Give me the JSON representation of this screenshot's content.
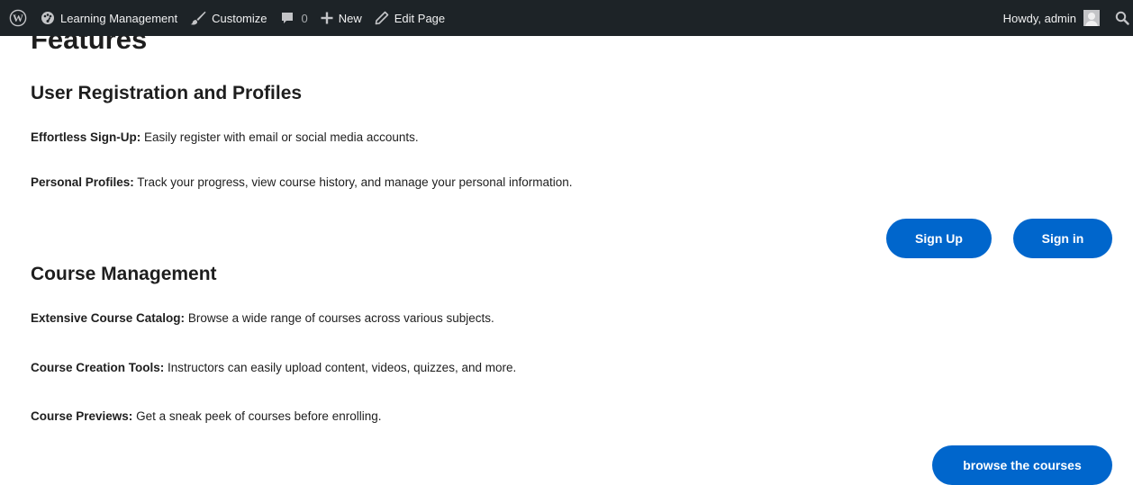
{
  "admin_bar": {
    "site_name": "Learning Management",
    "customize": "Customize",
    "comments_count": "0",
    "new": "New",
    "edit_page": "Edit Page",
    "howdy": "Howdy, admin"
  },
  "page": {
    "heading": "Features",
    "sections": [
      {
        "title": "User Registration and Profiles",
        "items": [
          {
            "label": "Effortless Sign-Up:",
            "text": " Easily register with email or social media accounts."
          },
          {
            "label": "Personal Profiles:",
            "text": " Track your progress, view course history, and manage your personal information."
          }
        ]
      },
      {
        "title": "Course Management",
        "items": [
          {
            "label": "Extensive Course Catalog:",
            "text": " Browse a wide range of courses across various subjects."
          },
          {
            "label": "Course Creation Tools:",
            "text": " Instructors can easily upload content, videos, quizzes, and more."
          },
          {
            "label": "Course Previews:",
            "text": " Get a sneak peek of courses before enrolling."
          }
        ]
      }
    ],
    "buttons": {
      "sign_up": "Sign Up",
      "sign_in": "Sign in",
      "browse": "browse the courses"
    }
  },
  "colors": {
    "admin_bar_bg": "#1d2327",
    "button_bg": "#0066cc"
  },
  "icons": {
    "wordpress": "wordpress-logo-icon",
    "site": "dashboard-icon",
    "customize": "brush-icon",
    "comments": "comment-icon",
    "new": "plus-icon",
    "edit": "pencil-icon",
    "search": "search-icon"
  }
}
